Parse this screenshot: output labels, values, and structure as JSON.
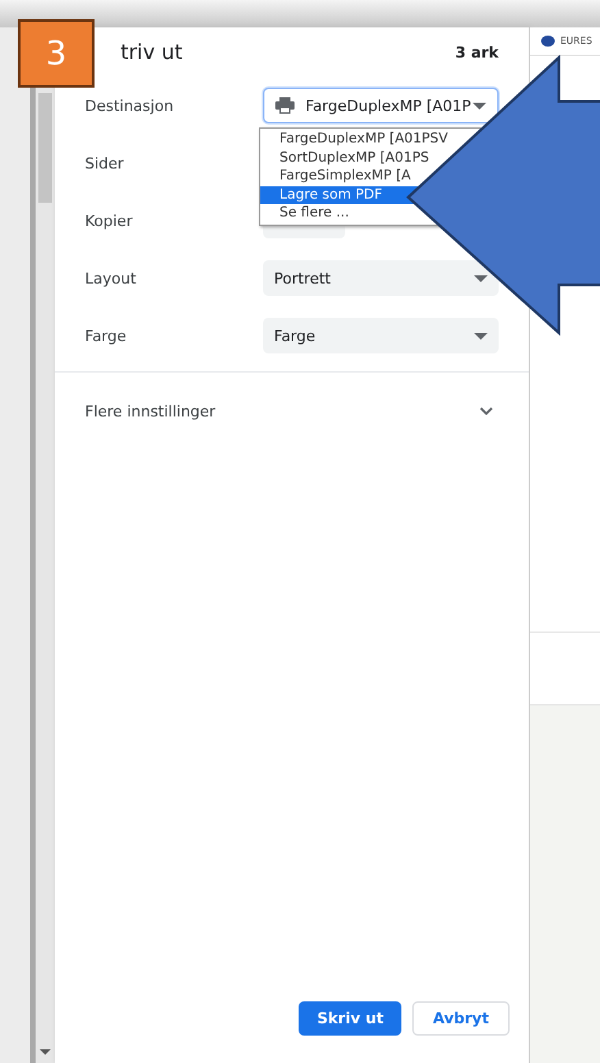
{
  "step_badge": "3",
  "dialog": {
    "title": "triv ut",
    "sheet_count": "3 ark",
    "settings": [
      {
        "label": "Destinasjon",
        "kind": "destination",
        "value": "FargeDuplexMP [A01P"
      },
      {
        "label": "Sider",
        "kind": "hidden"
      },
      {
        "label": "Kopier",
        "kind": "number"
      },
      {
        "label": "Layout",
        "kind": "select",
        "value": "Portrett"
      },
      {
        "label": "Farge",
        "kind": "select",
        "value": "Farge"
      }
    ],
    "more_settings": "Flere innstillinger",
    "buttons": [
      {
        "label": "Skriv ut",
        "kind": "primary"
      },
      {
        "label": "Avbryt",
        "kind": "secondary"
      }
    ]
  },
  "destination_menu": [
    {
      "label": "FargeDuplexMP [A01PSV",
      "selected": false
    },
    {
      "label": "SortDuplexMP [A01PS",
      "selected": false
    },
    {
      "label": "FargeSimplexMP [A",
      "selected": false
    },
    {
      "label": "Lagre som PDF",
      "selected": true
    },
    {
      "label": "Se flere ...",
      "selected": false
    }
  ],
  "background_page": {
    "header_text": "EURES"
  }
}
